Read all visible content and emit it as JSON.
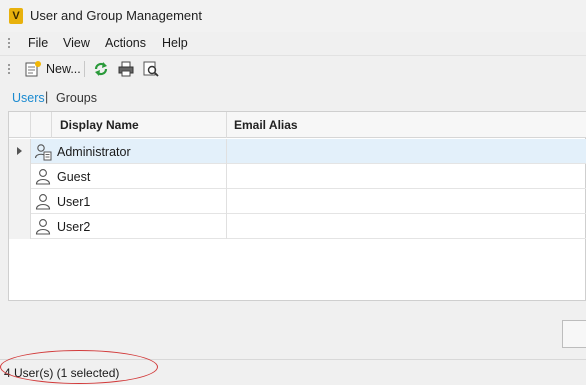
{
  "window": {
    "title": "User and Group Management",
    "app_icon": "V"
  },
  "menu": {
    "items": [
      "File",
      "View",
      "Actions",
      "Help"
    ]
  },
  "toolbar": {
    "new_label": "New...",
    "icons": [
      "new-icon",
      "refresh-icon",
      "print-icon",
      "print-preview-icon"
    ]
  },
  "view_tabs": {
    "users": "Users",
    "separator": "|",
    "groups": "Groups"
  },
  "grid": {
    "columns": [
      "Display Name",
      "Email Alias"
    ],
    "rows": [
      {
        "name": "Administrator",
        "email": "",
        "icon": "admin-user-icon",
        "selected": true
      },
      {
        "name": "Guest",
        "email": "",
        "icon": "user-icon",
        "selected": false
      },
      {
        "name": "User1",
        "email": "",
        "icon": "user-icon",
        "selected": false
      },
      {
        "name": "User2",
        "email": "",
        "icon": "user-icon",
        "selected": false
      }
    ]
  },
  "status": {
    "text": "4 User(s) (1 selected)"
  },
  "colors": {
    "accent_link": "#1a8ad0",
    "selected_row": "#e3f0fa",
    "highlight": "#d23a3a",
    "app_icon_bg": "#e8b10c"
  }
}
